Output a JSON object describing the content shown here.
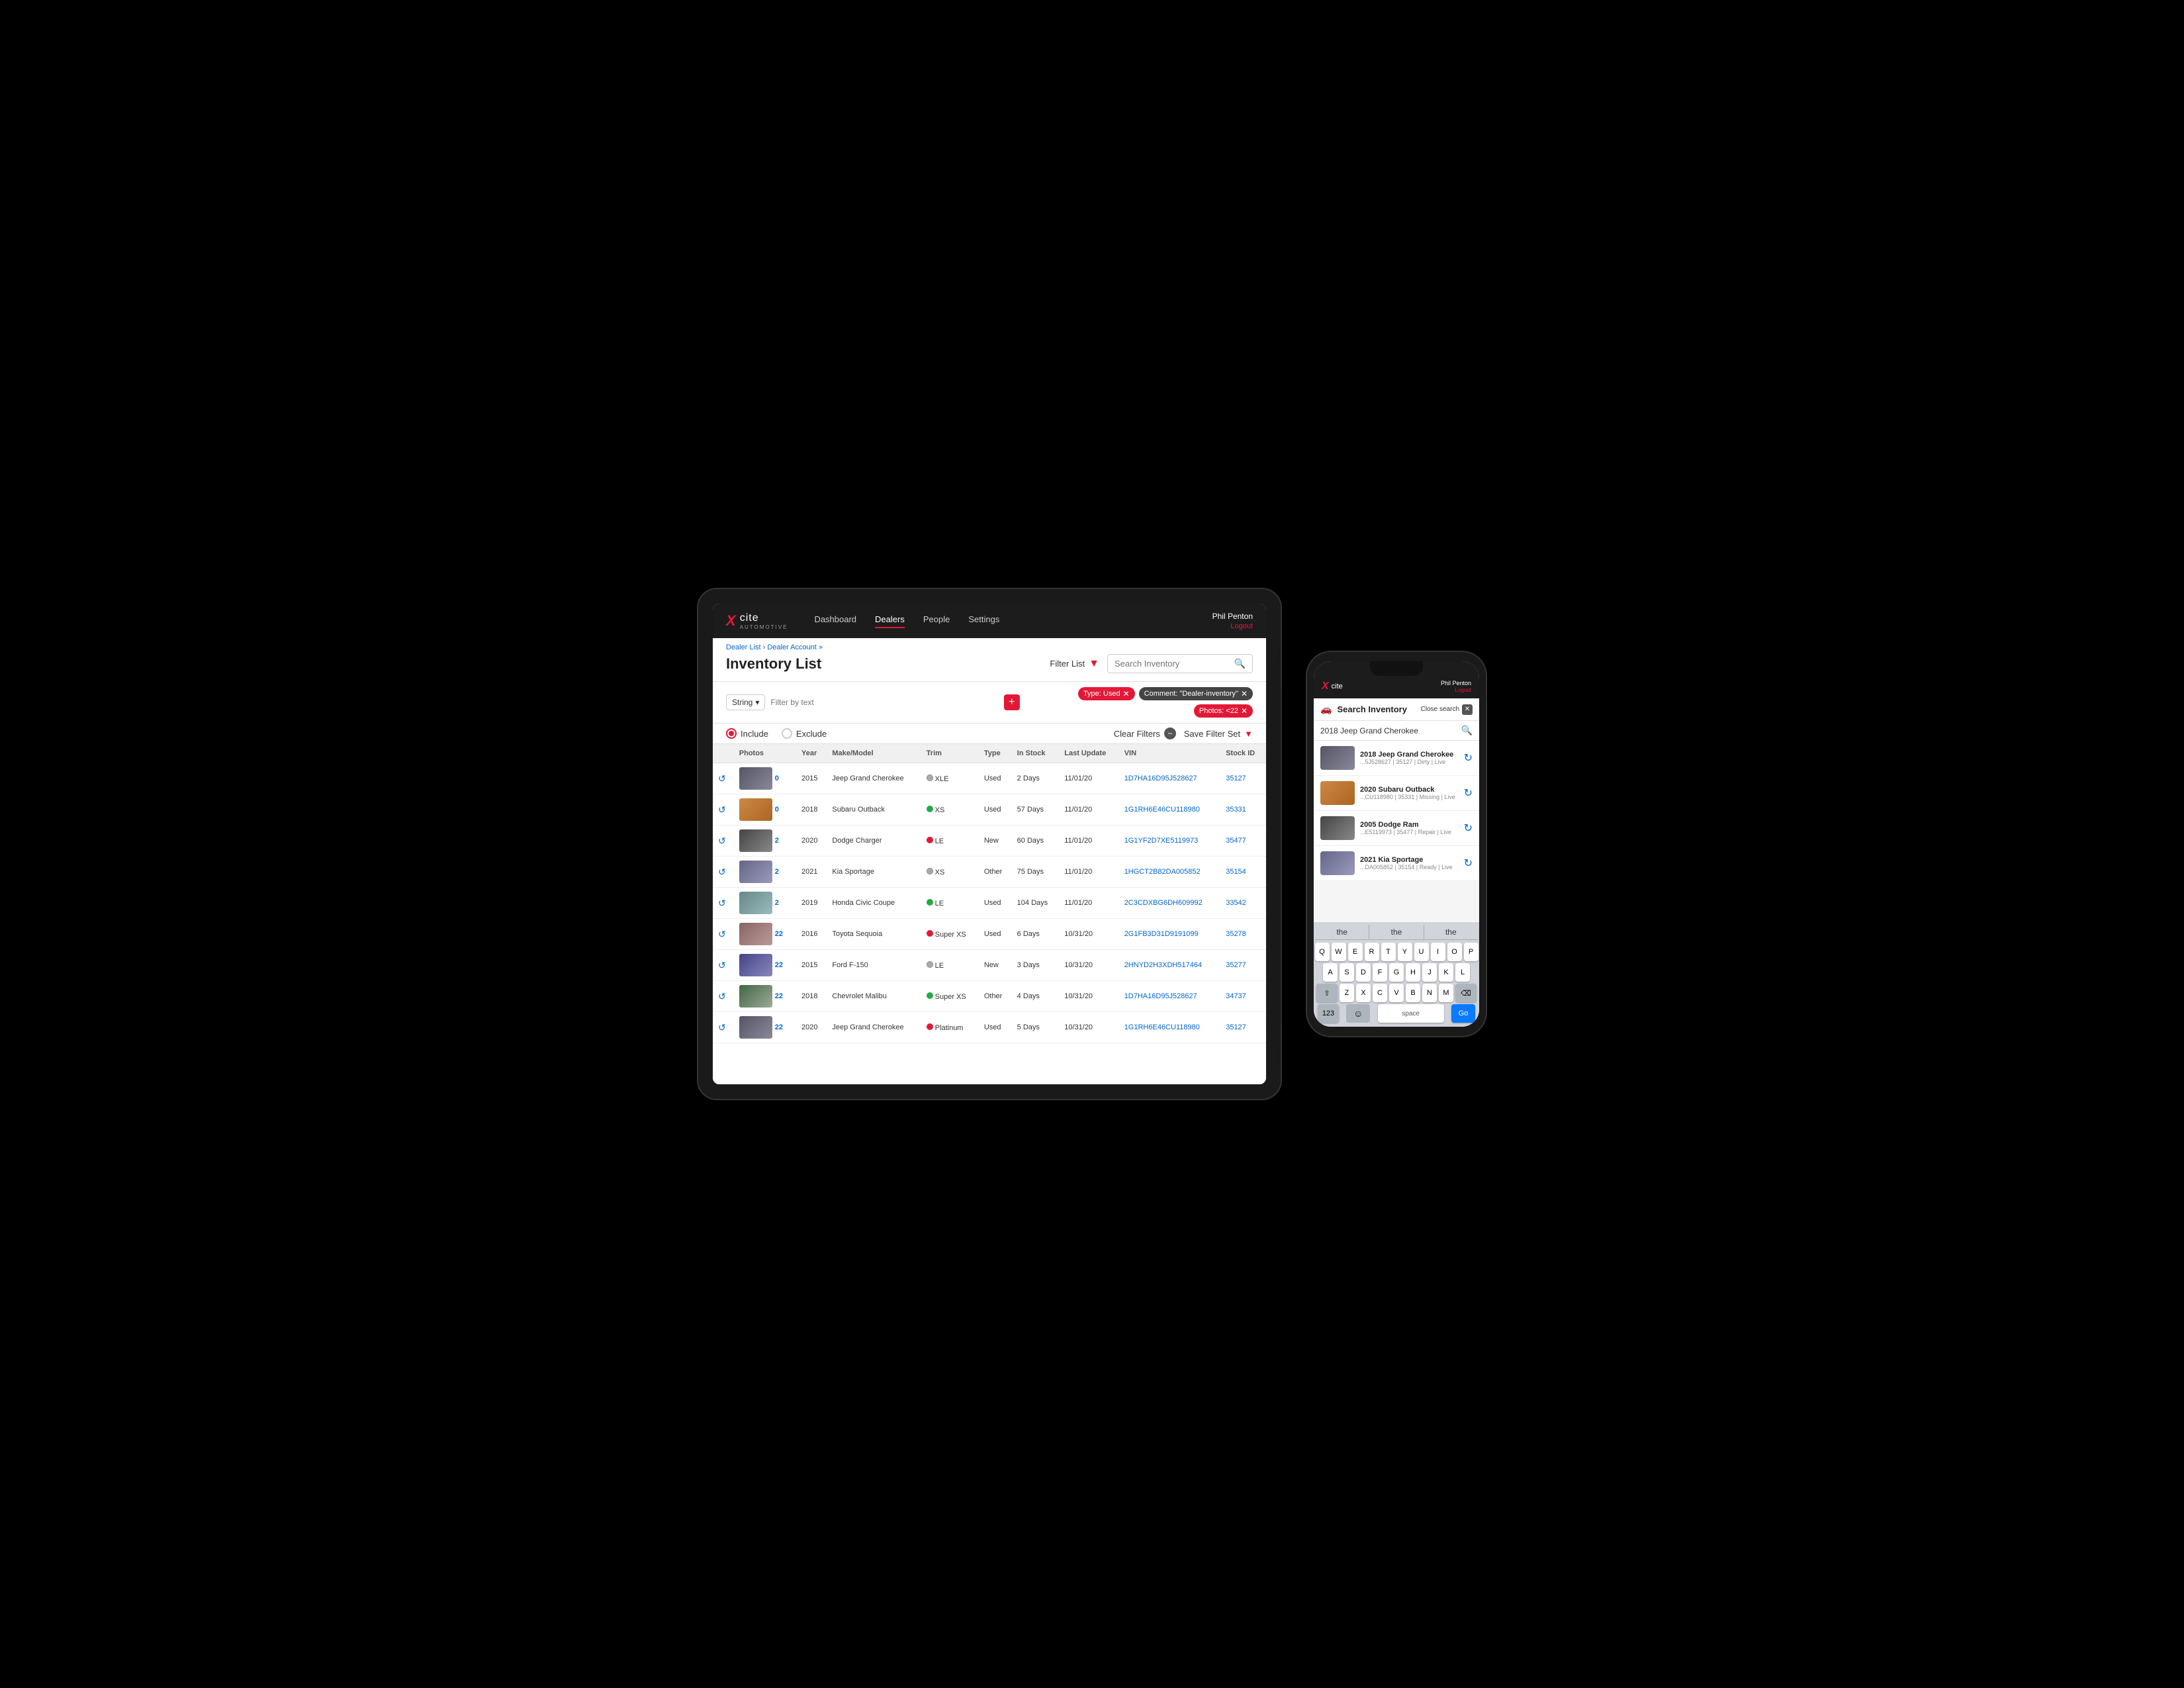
{
  "tablet": {
    "nav": {
      "logo_x": "X",
      "logo_cite": "cite",
      "logo_sub": "AUTOMOTIVE",
      "links": [
        {
          "label": "Dashboard",
          "active": false
        },
        {
          "label": "Dealers",
          "active": true
        },
        {
          "label": "People",
          "active": false
        },
        {
          "label": "Settings",
          "active": false
        }
      ],
      "user_name": "Phil Penton",
      "logout": "Logout"
    },
    "breadcrumb": "Dealer List › Dealer Account »",
    "page_title": "Inventory List",
    "filter_list_label": "Filter List",
    "search_placeholder": "Search Inventory",
    "filter": {
      "type_label": "String",
      "text_placeholder": "Filter by text",
      "active_filters": [
        {
          "label": "Type: Used",
          "color": "red"
        },
        {
          "label": "Comment: \"Dealer-inventory\"",
          "color": "dark"
        },
        {
          "label": "Photos: <22",
          "color": "red"
        }
      ]
    },
    "include_label": "Include",
    "exclude_label": "Exclude",
    "clear_filters": "Clear Filters",
    "save_filter_set": "Save Filter Set",
    "table": {
      "headers": [
        "",
        "Photos",
        "Year",
        "Make/Model",
        "Trim",
        "Type",
        "In Stock",
        "Last Update",
        "VIN",
        "Stock ID"
      ],
      "rows": [
        {
          "sync": "↺",
          "photos": "0",
          "year": "2015",
          "make_model": "Jeep Grand Cherokee",
          "trim": "XLE",
          "trim_status": "gray",
          "type": "Used",
          "in_stock": "2 Days",
          "last_update": "11/01/20",
          "vin": "1D7HA16D95J528627",
          "stock_id": "35127",
          "thumb": "jeep"
        },
        {
          "sync": "↺",
          "photos": "0",
          "year": "2018",
          "make_model": "Subaru Outback",
          "trim": "XS",
          "trim_status": "green",
          "type": "Used",
          "in_stock": "57 Days",
          "last_update": "11/01/20",
          "vin": "1G1RH6E46CU118980",
          "stock_id": "35331",
          "thumb": "subaru"
        },
        {
          "sync": "↺",
          "photos": "2",
          "year": "2020",
          "make_model": "Dodge Charger",
          "trim": "LE",
          "trim_status": "red",
          "type": "New",
          "in_stock": "60 Days",
          "last_update": "11/01/20",
          "vin": "1G1YF2D7XE5119973",
          "stock_id": "35477",
          "thumb": "dodge"
        },
        {
          "sync": "↺",
          "photos": "2",
          "year": "2021",
          "make_model": "Kia Sportage",
          "trim": "XS",
          "trim_status": "gray",
          "type": "Other",
          "in_stock": "75 Days",
          "last_update": "11/01/20",
          "vin": "1HGCT2B82DA005852",
          "stock_id": "35154",
          "thumb": "kia"
        },
        {
          "sync": "↺",
          "photos": "2",
          "year": "2019",
          "make_model": "Honda Civic Coupe",
          "trim": "LE",
          "trim_status": "green",
          "type": "Used",
          "in_stock": "104 Days",
          "last_update": "11/01/20",
          "vin": "2C3CDXBG6DH609992",
          "stock_id": "33542",
          "thumb": "honda"
        },
        {
          "sync": "↺",
          "photos": "22",
          "year": "2016",
          "make_model": "Toyota Sequoia",
          "trim": "Super XS",
          "trim_status": "red",
          "type": "Used",
          "in_stock": "6 Days",
          "last_update": "10/31/20",
          "vin": "2G1FB3D31D9191099",
          "stock_id": "35278",
          "thumb": "toyota"
        },
        {
          "sync": "↺",
          "photos": "22",
          "year": "2015",
          "make_model": "Ford F-150",
          "trim": "LE",
          "trim_status": "gray",
          "type": "New",
          "in_stock": "3 Days",
          "last_update": "10/31/20",
          "vin": "2HNYD2H3XDH517464",
          "stock_id": "35277",
          "thumb": "ford"
        },
        {
          "sync": "↺",
          "photos": "22",
          "year": "2018",
          "make_model": "Chevrolet Malibu",
          "trim": "Super XS",
          "trim_status": "green",
          "type": "Other",
          "in_stock": "4 Days",
          "last_update": "10/31/20",
          "vin": "1D7HA16D95J528627",
          "stock_id": "34737",
          "thumb": "chevy"
        },
        {
          "sync": "↺",
          "photos": "22",
          "year": "2020",
          "make_model": "Jeep Grand Cherokee",
          "trim": "Platinum",
          "trim_status": "red",
          "type": "Used",
          "in_stock": "5 Days",
          "last_update": "10/31/20",
          "vin": "1G1RH6E46CU118980",
          "stock_id": "35127",
          "thumb": "jeep"
        }
      ]
    }
  },
  "phone": {
    "nav": {
      "logo_x": "X",
      "logo_cite": "cite",
      "user_name": "Phil Penton",
      "logout": "Logout"
    },
    "search_title": "Search Inventory",
    "close_search": "Close search",
    "search_value": "2018 Jeep Grand Cherokee",
    "results": [
      {
        "title": "2018 Jeep Grand Cherokee",
        "meta": "...5J528627 | 35127 | Dirty | Live",
        "thumb": "jeep"
      },
      {
        "title": "2020 Subaru Outback",
        "meta": "...CU118980 | 35331 | Missing | Live",
        "thumb": "subaru"
      },
      {
        "title": "2005 Dodge Ram",
        "meta": "...E5119973 | 35477 | Repair | Live",
        "thumb": "dodge"
      },
      {
        "title": "2021 Kia Sportage",
        "meta": "...DA005852 | 35154 | Ready | Live",
        "thumb": "kia"
      }
    ],
    "keyboard": {
      "suggestions": [
        "the",
        "the",
        "the"
      ],
      "rows": [
        [
          "Q",
          "W",
          "E",
          "R",
          "T",
          "Y",
          "U",
          "I",
          "O",
          "P"
        ],
        [
          "A",
          "S",
          "D",
          "F",
          "G",
          "H",
          "J",
          "K",
          "L"
        ],
        [
          "⇧",
          "Z",
          "X",
          "C",
          "V",
          "B",
          "N",
          "M",
          "⌫"
        ],
        [
          "123",
          "space",
          "Go"
        ]
      ]
    }
  }
}
